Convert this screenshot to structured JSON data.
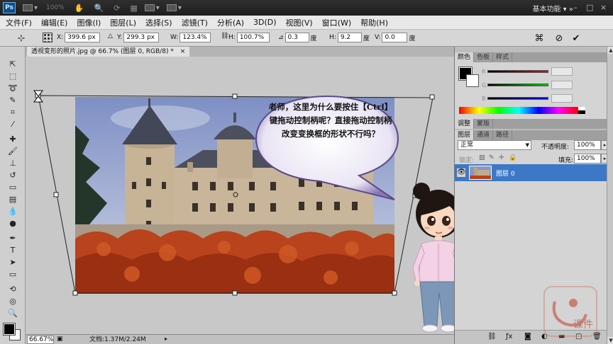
{
  "appbar": {
    "logo": "Ps",
    "zoom": "100%",
    "workspace": "基本功能",
    "minimize": "–",
    "restore": "□",
    "close": "×"
  },
  "menu": [
    "文件(F)",
    "编辑(E)",
    "图像(I)",
    "图层(L)",
    "选择(S)",
    "滤镜(T)",
    "分析(A)",
    "3D(D)",
    "视图(V)",
    "窗口(W)",
    "帮助(H)"
  ],
  "options": {
    "x_label": "X:",
    "x_value": "399.6 px",
    "y_label": "Y:",
    "y_value": "299.3 px",
    "w_label": "W:",
    "w_value": "123.4%",
    "h_label": "H:",
    "h_value": "100.7%",
    "angle_value": "0.3",
    "angle_unit": "度",
    "hs_label": "H:",
    "hs_value": "9.2",
    "hs_unit": "度",
    "vs_label": "V:",
    "vs_value": "0.0",
    "vs_unit": "度"
  },
  "document": {
    "tab_title": "透视变形的照片.jpg @ 66.7% (图层 0, RGB/8) *",
    "tab_close": "×"
  },
  "speech_bubble": "老师，这里为什么要按住【Ctrl】键拖动控制柄呢？直接拖动控制柄改变变换框的形状不行吗？",
  "status": {
    "zoom": "66.67%",
    "doc_info": "文档:1.37M/2.24M"
  },
  "panels": {
    "color_tabs": [
      "颜色",
      "色板",
      "样式"
    ],
    "slider_labels": [
      "R",
      "G",
      "B"
    ],
    "adjust_tabs": [
      "调整",
      "蒙版"
    ],
    "layer_tabs": [
      "图层",
      "通道",
      "路径"
    ],
    "blend_mode": "正常",
    "opacity_label": "不透明度:",
    "opacity": "100%",
    "lock_label": "锁定:",
    "fill_label": "填充:",
    "fill": "100%",
    "layer_name": "图层 0"
  },
  "watermark": "课件",
  "colors": {
    "layer_selected": "#3d78c6",
    "foreground": "#000000",
    "background": "#ffffff"
  }
}
